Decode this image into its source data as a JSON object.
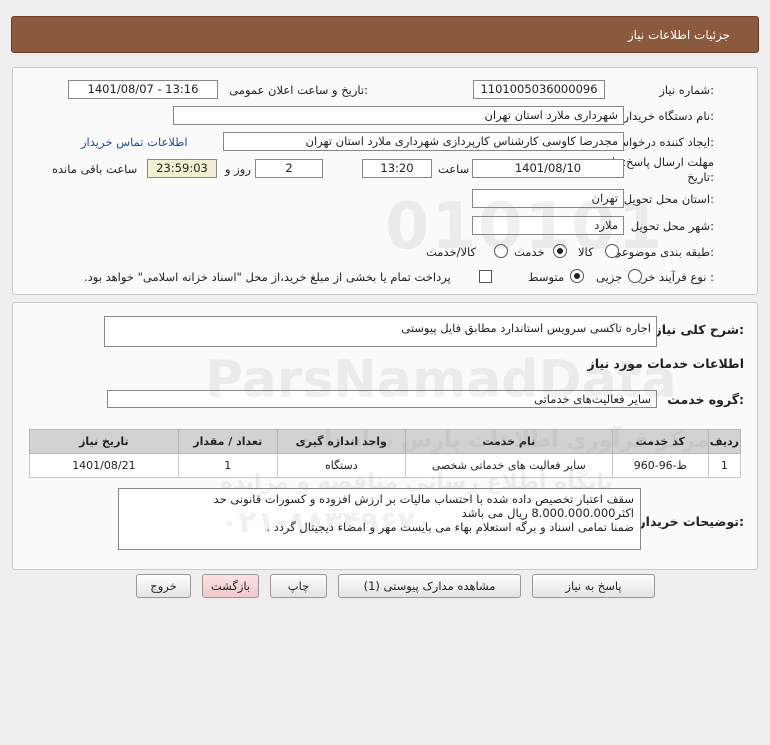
{
  "header": {
    "title": "جزئیات اطلاعات نیاز"
  },
  "info": {
    "need_number_label": "شماره نیاز:",
    "need_number": "1101005036000096",
    "announce_label": "تاریخ و ساعت اعلان عمومی:",
    "announce_value": "1401/08/07 - 13:16",
    "buyer_org_label": "نام دستگاه خریدار:",
    "buyer_org": "شهرداری ملارد استان تهران",
    "creator_label": "ایجاد کننده درخواست:",
    "creator": "مجدرضا کاوسی کارشناس کارپردازی شهرداری ملارد استان تهران",
    "contact_link": "اطلاعات تماس خریدار",
    "deadline_label": "مهلت ارسال پاسخ: تا تاریخ:",
    "deadline_date": "1401/08/10",
    "time_label": "ساعت",
    "deadline_time": "13:20",
    "days_value": "2",
    "days_label": "روز و",
    "remaining_time": "23:59:03",
    "remaining_label": "ساعت باقی مانده",
    "province_label": "استان محل تحویل:",
    "province": "تهران",
    "city_label": "شهر محل تحویل:",
    "city": "ملارد",
    "category_label": "طبقه بندی موضوعی:",
    "category_options": [
      "کالا",
      "خدمت",
      "کالا/خدمت"
    ],
    "category_selected": "خدمت",
    "process_label": "نوع فرآیند خرید :",
    "process_options": [
      "جزیی",
      "متوسط"
    ],
    "process_selected": "متوسط",
    "payment_note": "پرداخت تمام یا بخشی از مبلغ خرید،از محل \"اسناد خزانه اسلامی\" خواهد بود."
  },
  "details": {
    "summary_label": "شرح کلی نیاز:",
    "summary": "اجاره تاکسی سرویس استاندارد مطابق فایل پیوستی",
    "services_heading": "اطلاعات خدمات مورد نیاز",
    "group_label": "گروه خدمت:",
    "group_value": "سایر فعالیت‌های خدماتی",
    "table": {
      "headers": [
        "ردیف",
        "کد خدمت",
        "نام خدمت",
        "واحد اندازه گیری",
        "تعداد / مقدار",
        "تاریخ نیاز"
      ],
      "rows": [
        [
          "1",
          "ط-96-960",
          "سایر فعالیت های خدماتی شخصی",
          "دستگاه",
          "1",
          "1401/08/21"
        ]
      ]
    },
    "buyer_notes_label": "توضیحات خریدار:",
    "buyer_notes": [
      "سقف اعتبار تخصیص داده شده با احتساب مالیات بر ارزش افزوده و کسورات قانونی حد",
      "اکثر8.000.000.000 ریال می باشد",
      "ضمنا تمامی اسناد و برگه استعلام بهاء می بایست مهر و امضاء دیجیتال گردد ."
    ]
  },
  "buttons": {
    "reply": "پاسخ به نیاز",
    "attachments": "مشاهده مدارک پیوستی (1)",
    "print": "چاپ",
    "back": "بازگشت",
    "exit": "خروج"
  },
  "watermark": {
    "digits": "010101",
    "brand": "ParsNamadData",
    "persian_line": "مرکز فرآوری اطلاعات پارس نماد داده",
    "persian_line2": "پایگاه اطلاع رسانی مناقصه و مزایده",
    "phone": "۰۲۱-۸۸۳۴۹۶۷۰"
  },
  "colors": {
    "header_bg": "#8b5a3c",
    "link": "#1a4fa0",
    "remaining_bg": "#f3f0d2"
  }
}
